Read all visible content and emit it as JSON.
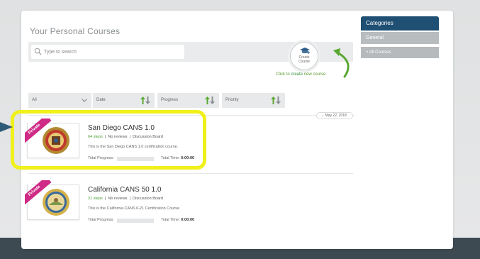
{
  "colors": {
    "category_header": "#1f4f73",
    "private_ribbon": "#cf2a86",
    "highlight": "#f0f01a",
    "step_green": "#4a9c2f",
    "arrow_green": "#5aa832"
  },
  "page_title": "Your Personal Courses",
  "search": {
    "placeholder": "Type to search",
    "icon": "search-icon"
  },
  "create": {
    "label_line1": "Create",
    "label_line2": "Course",
    "icon": "graduation-cap-plus-icon"
  },
  "create_hint": {
    "prefix": "Click to ",
    "link": "create",
    "suffix": " new course"
  },
  "filters": {
    "all": "All",
    "date": "Date",
    "progress": "Progress",
    "priority": "Priority"
  },
  "date_group": "May 22, 2018",
  "courses": [
    {
      "title": "San Diego CANS 1.0",
      "steps": "64 steps",
      "reviews": "No reviews",
      "board": "Discussion Board",
      "description": "This is the San Diego CANS 1.0 certification course.",
      "badge": "Private",
      "progress_label": "Total Progress:",
      "progress": 0,
      "time_label": "Total Time:",
      "time_value": "0:00:00"
    },
    {
      "title": "California CANS 50 1.0",
      "steps": "31 steps",
      "reviews": "No reviews",
      "board": "Discussion Board",
      "description": "This is the California CANS 6-21 Certification Course.",
      "badge": "Private",
      "progress_label": "Total Progress:",
      "progress": 0,
      "time_label": "Total Time:",
      "time_value": "0:00:00"
    }
  ],
  "sidebar": {
    "header": "Categories",
    "items": [
      {
        "label": "General"
      },
      {
        "label": "All Courses"
      }
    ]
  }
}
